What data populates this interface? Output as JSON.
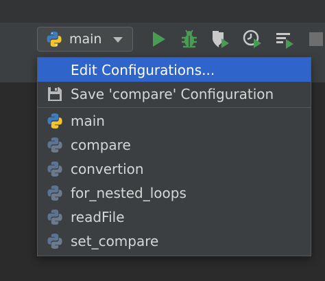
{
  "toolbar": {
    "run_config": {
      "selected": "main"
    },
    "icons": [
      "run-icon",
      "debug-icon",
      "coverage-icon",
      "profile-icon",
      "concurrency-icon",
      "stop-icon"
    ]
  },
  "colors": {
    "selection": "#2f65ca",
    "run_green": "#499c54",
    "python_blue": "#3b7dbf",
    "python_yellow": "#f4c430"
  },
  "menu": {
    "actions": [
      {
        "label": "Edit Configurations...",
        "icon": "none",
        "selected": true
      },
      {
        "label": "Save 'compare' Configuration",
        "icon": "floppy-disk-icon",
        "selected": false
      }
    ],
    "configurations": [
      {
        "label": "main",
        "active": true
      },
      {
        "label": "compare",
        "active": false
      },
      {
        "label": "convertion",
        "active": false
      },
      {
        "label": "for_nested_loops",
        "active": false
      },
      {
        "label": "readFile",
        "active": false
      },
      {
        "label": "set_compare",
        "active": false
      }
    ]
  }
}
